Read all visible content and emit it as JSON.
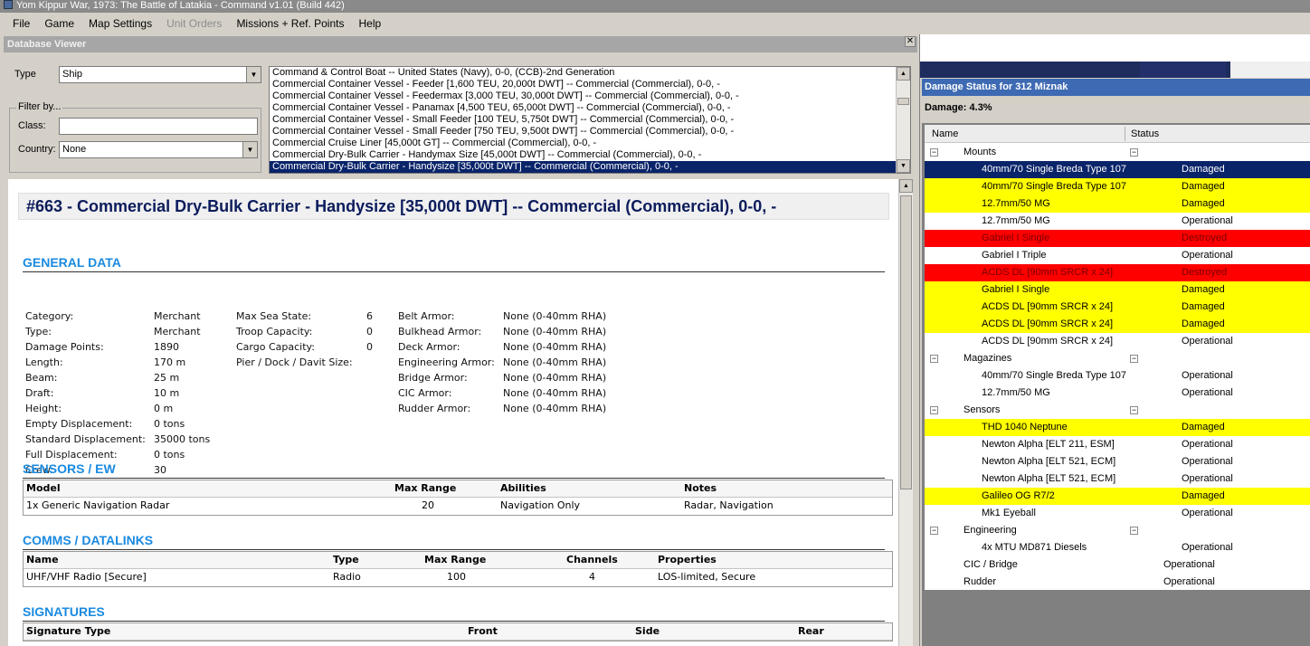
{
  "app": {
    "title": "Yom Kippur War, 1973: The Battle of Latakia  - Command v1.01 (Build 442)"
  },
  "menu": [
    {
      "label": "File",
      "disabled": false
    },
    {
      "label": "Game",
      "disabled": false
    },
    {
      "label": "Map Settings",
      "disabled": false
    },
    {
      "label": "Unit Orders",
      "disabled": true
    },
    {
      "label": "Missions + Ref. Points",
      "disabled": false
    },
    {
      "label": "Help",
      "disabled": false
    }
  ],
  "db_viewer": {
    "title": "Database Viewer",
    "close_glyph": "✕",
    "type_label": "Type",
    "type_value": "Ship",
    "filter_label": "Filter by...",
    "class_label": "Class:",
    "class_value": "",
    "country_label": "Country:",
    "country_value": "None",
    "type_list": [
      {
        "text": "Command & Control Boat -- United States (Navy), 0-0, (CCB)-2nd Generation",
        "selected": false
      },
      {
        "text": "Commercial Container Vessel - Feeder [1,600 TEU, 20,000t DWT] -- Commercial (Commercial), 0-0, -",
        "selected": false
      },
      {
        "text": "Commercial Container Vessel - Feedermax [3,000 TEU, 30,000t DWT] -- Commercial (Commercial), 0-0, -",
        "selected": false
      },
      {
        "text": "Commercial Container Vessel - Panamax [4,500 TEU, 65,000t DWT] -- Commercial (Commercial), 0-0, -",
        "selected": false
      },
      {
        "text": "Commercial Container Vessel - Small Feeder [100 TEU, 5,750t DWT] -- Commercial (Commercial), 0-0, -",
        "selected": false
      },
      {
        "text": "Commercial Container Vessel - Small Feeder [750 TEU, 9,500t DWT] -- Commercial (Commercial), 0-0, -",
        "selected": false
      },
      {
        "text": "Commercial Cruise Liner [45,000t GT] -- Commercial (Commercial), 0-0, -",
        "selected": false
      },
      {
        "text": "Commercial Dry-Bulk Carrier - Handymax Size [45,000t DWT] -- Commercial (Commercial), 0-0, -",
        "selected": false
      },
      {
        "text": "Commercial Dry-Bulk Carrier - Handysize [35,000t DWT] -- Commercial (Commercial), 0-0, -",
        "selected": true
      }
    ],
    "detail": {
      "heading": "#663 - Commercial Dry-Bulk Carrier - Handysize [35,000t DWT] -- Commercial (Commercial), 0-0, -",
      "general_title": "GENERAL DATA",
      "general_col1": [
        {
          "k": "Category:",
          "v": "Merchant"
        },
        {
          "k": "Type:",
          "v": "Merchant"
        },
        {
          "k": "Damage Points:",
          "v": "1890"
        },
        {
          "k": "Length:",
          "v": "170 m"
        },
        {
          "k": "Beam:",
          "v": "25 m"
        },
        {
          "k": "Draft:",
          "v": "10 m"
        },
        {
          "k": "Height:",
          "v": "0 m"
        },
        {
          "k": "Empty Displacement:",
          "v": "0 tons"
        },
        {
          "k": "Standard Displacement:",
          "v": "35000 tons"
        },
        {
          "k": "Full Displacement:",
          "v": "0 tons"
        },
        {
          "k": "Crew:",
          "v": "30"
        }
      ],
      "general_col2": [
        {
          "k": "Max Sea State:",
          "v": "6"
        },
        {
          "k": "Troop Capacity:",
          "v": "0"
        },
        {
          "k": "Cargo Capacity:",
          "v": "0"
        },
        {
          "k": "Pier / Dock / Davit Size:",
          "v": ""
        }
      ],
      "general_col3": [
        {
          "k": "Belt Armor:",
          "v": "None (0-40mm RHA)"
        },
        {
          "k": "Bulkhead Armor:",
          "v": "None (0-40mm RHA)"
        },
        {
          "k": "Deck Armor:",
          "v": "None (0-40mm RHA)"
        },
        {
          "k": "Engineering Armor:",
          "v": "None (0-40mm RHA)"
        },
        {
          "k": "Bridge Armor:",
          "v": "None (0-40mm RHA)"
        },
        {
          "k": "CIC Armor:",
          "v": "None (0-40mm RHA)"
        },
        {
          "k": "Rudder Armor:",
          "v": "None (0-40mm RHA)"
        }
      ],
      "sensors_title": "SENSORS / EW",
      "sensors_headers": [
        "Model",
        "Max Range",
        "Abilities",
        "Notes"
      ],
      "sensors_rows": [
        [
          "1x Generic Navigation Radar",
          "20",
          "Navigation Only",
          "Radar, Navigation"
        ]
      ],
      "comms_title": "COMMS / DATALINKS",
      "comms_headers": [
        "Name",
        "Type",
        "Max Range",
        "Channels",
        "Properties"
      ],
      "comms_rows": [
        [
          "UHF/VHF Radio [Secure]",
          "Radio",
          "100",
          "4",
          "LOS-limited, Secure"
        ]
      ],
      "signatures_title": "SIGNATURES",
      "signatures_headers": [
        "Signature Type",
        "Front",
        "Side",
        "Rear"
      ]
    }
  },
  "damage": {
    "title": "Damage Status for 312 Miznak",
    "damage_text": "Damage: 4.3%",
    "col_name": "Name",
    "col_status": "Status",
    "colors": {
      "damaged": "#ffff00",
      "destroyed": "#ff0000",
      "selected": "#0a246a"
    },
    "rows": [
      {
        "name": "Mounts",
        "status": "",
        "level": 1,
        "expander": true,
        "state": "group"
      },
      {
        "name": "40mm/70 Single Breda Type 107",
        "status": "Damaged",
        "level": 2,
        "state": "selected"
      },
      {
        "name": "40mm/70 Single Breda Type 107",
        "status": "Damaged",
        "level": 2,
        "state": "damaged"
      },
      {
        "name": "12.7mm/50 MG",
        "status": "Damaged",
        "level": 2,
        "state": "damaged"
      },
      {
        "name": "12.7mm/50 MG",
        "status": "Operational",
        "level": 2,
        "state": "normal"
      },
      {
        "name": "Gabriel I Single",
        "status": "Destroyed",
        "level": 2,
        "state": "destroyed"
      },
      {
        "name": "Gabriel I Triple",
        "status": "Operational",
        "level": 2,
        "state": "normal"
      },
      {
        "name": "ACDS DL [90mm SRCR x 24]",
        "status": "Destroyed",
        "level": 2,
        "state": "destroyed"
      },
      {
        "name": "Gabriel I Single",
        "status": "Damaged",
        "level": 2,
        "state": "damaged"
      },
      {
        "name": "ACDS DL [90mm SRCR x 24]",
        "status": "Damaged",
        "level": 2,
        "state": "damaged"
      },
      {
        "name": "ACDS DL [90mm SRCR x 24]",
        "status": "Damaged",
        "level": 2,
        "state": "damaged"
      },
      {
        "name": "ACDS DL [90mm SRCR x 24]",
        "status": "Operational",
        "level": 2,
        "state": "normal"
      },
      {
        "name": "Magazines",
        "status": "",
        "level": 1,
        "expander": true,
        "state": "group"
      },
      {
        "name": "40mm/70 Single Breda Type 107",
        "status": "Operational",
        "level": 2,
        "state": "normal"
      },
      {
        "name": "12.7mm/50 MG",
        "status": "Operational",
        "level": 2,
        "state": "normal"
      },
      {
        "name": "Sensors",
        "status": "",
        "level": 1,
        "expander": true,
        "state": "group"
      },
      {
        "name": "THD 1040 Neptune",
        "status": "Damaged",
        "level": 2,
        "state": "damaged"
      },
      {
        "name": "Newton Alpha [ELT 211, ESM]",
        "status": "Operational",
        "level": 2,
        "state": "normal"
      },
      {
        "name": "Newton Alpha [ELT 521, ECM]",
        "status": "Operational",
        "level": 2,
        "state": "normal"
      },
      {
        "name": "Newton Alpha [ELT 521, ECM]",
        "status": "Operational",
        "level": 2,
        "state": "normal"
      },
      {
        "name": "Galileo OG R7/2",
        "status": "Damaged",
        "level": 2,
        "state": "damaged"
      },
      {
        "name": "Mk1 Eyeball",
        "status": "Operational",
        "level": 2,
        "state": "normal"
      },
      {
        "name": "Engineering",
        "status": "",
        "level": 1,
        "expander": true,
        "state": "group"
      },
      {
        "name": "4x MTU MD871 Diesels",
        "status": "Operational",
        "level": 2,
        "state": "normal"
      },
      {
        "name": "CIC / Bridge",
        "status": "Operational",
        "level": 0,
        "state": "normal"
      },
      {
        "name": "Rudder",
        "status": "Operational",
        "level": 0,
        "state": "normal"
      }
    ]
  }
}
